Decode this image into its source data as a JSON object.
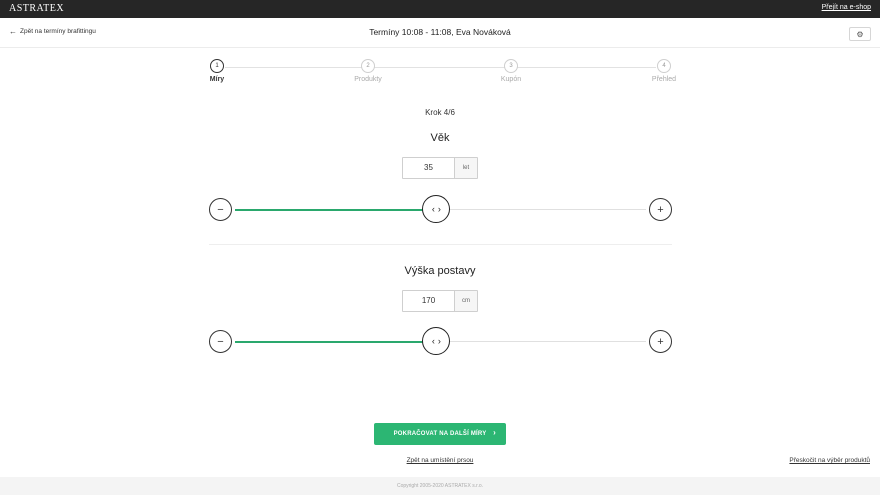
{
  "topbar": {
    "logo": "ASTRATEX",
    "eshop_link": "Přejít na e-shop"
  },
  "subheader": {
    "back_label": "Zpět na termíny brafittingu",
    "title": "Termíny 10:08 - 11:08, Eva Nováková",
    "settings_icon": "gear-icon"
  },
  "stepper": {
    "steps": [
      {
        "number": "1",
        "label": "Míry",
        "active": true
      },
      {
        "number": "2",
        "label": "Produkty",
        "active": false
      },
      {
        "number": "3",
        "label": "Kupón",
        "active": false
      },
      {
        "number": "4",
        "label": "Přehled",
        "active": false
      }
    ]
  },
  "step_count": "Krok 4/6",
  "age": {
    "title": "Věk",
    "value": "35",
    "unit": "let",
    "fill_fraction": 0.49
  },
  "height": {
    "title": "Výška postavy",
    "value": "170",
    "unit": "cm",
    "fill_fraction": 0.49
  },
  "actions": {
    "continue_label": "POKRAČOVAT NA DALŠÍ MÍRY",
    "back_label": "Zpět na umístění prsou",
    "skip_label": "Přeskočit na výběr produktů"
  },
  "footer": {
    "copyright": "Copyright 2005-2020 ASTRATEX s.r.o."
  },
  "colors": {
    "accent": "#2cb673",
    "topbar": "#262626"
  }
}
